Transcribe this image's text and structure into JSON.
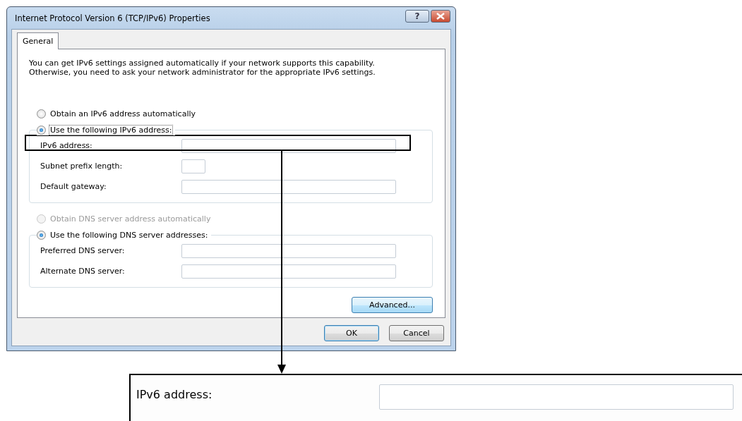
{
  "window": {
    "title": "Internet Protocol Version 6 (TCP/IPv6) Properties",
    "help_button": "?"
  },
  "tabs": [
    {
      "label": "General",
      "selected": true
    }
  ],
  "description": "You can get IPv6 settings assigned automatically if your network supports this capability.\nOtherwise, you need to ask your network administrator for the appropriate IPv6 settings.",
  "ip_settings": {
    "auto_option": {
      "label": "Obtain an IPv6 address automatically",
      "selected": false,
      "disabled": false,
      "focused": false
    },
    "manual_option": {
      "label": "Use the following IPv6 address:",
      "selected": true,
      "disabled": false,
      "focused": true
    },
    "fields": [
      {
        "label": "IPv6 address:",
        "kind": "wide"
      },
      {
        "label": "Subnet prefix length:",
        "kind": "short"
      },
      {
        "label": "Default gateway:",
        "kind": "wide"
      }
    ]
  },
  "dns_settings": {
    "auto_option": {
      "label": "Obtain DNS server address automatically",
      "selected": false,
      "disabled": true,
      "focused": false
    },
    "manual_option": {
      "label": "Use the following DNS server addresses:",
      "selected": true,
      "disabled": false,
      "focused": false
    },
    "fields": [
      {
        "label": "Preferred DNS server:",
        "kind": "wide"
      },
      {
        "label": "Alternate DNS server:",
        "kind": "wide"
      }
    ]
  },
  "advanced_button": {
    "label": "Advanced..."
  },
  "buttons": [
    {
      "label": "OK",
      "default": true
    },
    {
      "label": "Cancel",
      "default": false
    }
  ],
  "callout": {
    "label": "IPv6 address:"
  }
}
